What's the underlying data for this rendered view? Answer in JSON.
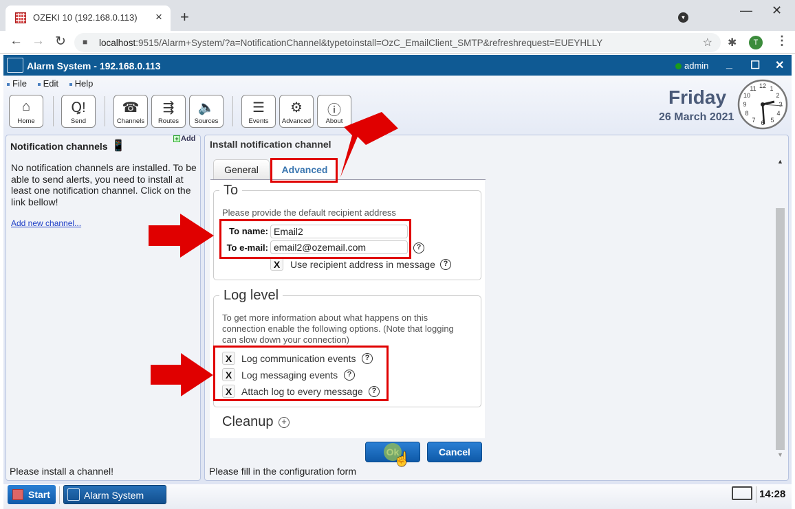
{
  "browser": {
    "tab_title": "OZEKI 10 (192.168.0.113)",
    "url_host": "localhost",
    "url_rest": ":9515/Alarm+System/?a=NotificationChannel&typetoinstall=OzC_EmailClient_SMTP&refreshrequest=EUEYHLLY",
    "profile_initial": "T",
    "icons": {
      "close_tab": "×",
      "new_tab": "+",
      "back": "←",
      "forward": "→",
      "reload": "↻",
      "lock": "🔒",
      "star": "☆",
      "extensions": "✱",
      "menu": "⋮",
      "minimize": "—",
      "maximize": "☐",
      "close": "✕"
    }
  },
  "app": {
    "title": "Alarm System - 192.168.0.113",
    "user": "admin",
    "user_status_color": "#1b9b1b",
    "window_buttons": {
      "minimize": "_",
      "maximize": "☐",
      "close": "✕"
    },
    "menu": [
      "File",
      "Edit",
      "Help"
    ],
    "toolbar": [
      {
        "label": "Home",
        "icon": "⌂"
      },
      {
        "label": "Send",
        "icon": "Ꝗ!"
      },
      {
        "label": "Channels",
        "icon": "☎"
      },
      {
        "label": "Routes",
        "icon": "⇶"
      },
      {
        "label": "Sources",
        "icon": "🔈"
      },
      {
        "label": "Events",
        "icon": "☰"
      },
      {
        "label": "Advanced",
        "icon": "⚙"
      },
      {
        "label": "About",
        "icon": "ⓘ"
      }
    ],
    "day": "Friday",
    "date": "26 March 2021",
    "clock_time": "14:28"
  },
  "left_panel": {
    "title": "Notification channels",
    "add_label": "Add",
    "body": "No notification channels are installed. To be able to send alerts, you need to install at least one notification channel. Click on the link bellow!",
    "link": "Add new channel...",
    "status": "Please install a channel!"
  },
  "right_panel": {
    "title": "Install notification channel",
    "tabs": [
      {
        "label": "General",
        "active": false
      },
      {
        "label": "Advanced",
        "active": true
      }
    ],
    "to_section": {
      "legend": "To",
      "description": "Please provide the default recipient address",
      "to_name_label": "To name:",
      "to_name_value": "Email2",
      "to_email_label": "To e-mail:",
      "to_email_value": "email2@ozemail.com",
      "use_recipient_label": "Use recipient address in message",
      "use_recipient_checked": true
    },
    "log_section": {
      "legend": "Log level",
      "description": "To get more information about what happens on this connection enable the following options. (Note that logging can slow down your connection)",
      "options": [
        {
          "label": "Log communication events",
          "checked": true
        },
        {
          "label": "Log messaging events",
          "checked": true
        },
        {
          "label": "Attach log to every message",
          "checked": true
        }
      ]
    },
    "cleanup_label": "Cleanup",
    "check_mark": "X",
    "help_mark": "?",
    "ok_label": "Ok",
    "cancel_label": "Cancel",
    "status": "Please fill in the configuration form"
  },
  "taskbar": {
    "start_label": "Start",
    "app_label": "Alarm System",
    "time": "14:28"
  },
  "annotation_color": "#e00000"
}
